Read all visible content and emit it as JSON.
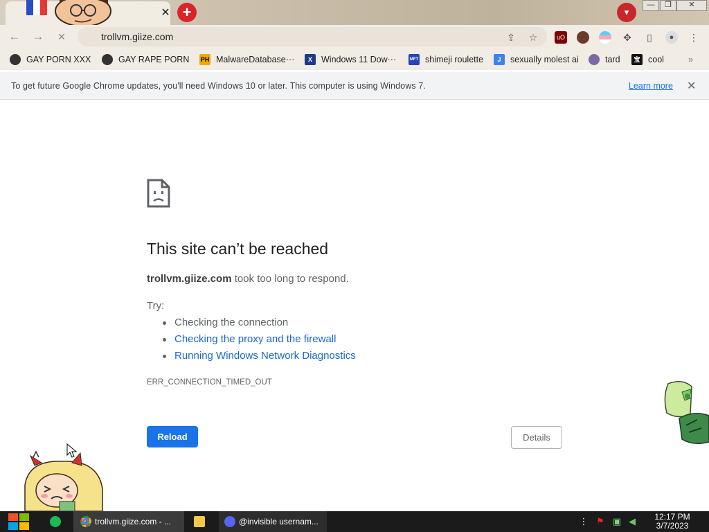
{
  "tab": {
    "close_label": "✕",
    "new_tab_label": "+"
  },
  "window_controls": {
    "minimize": "—",
    "restore": "❐",
    "close": "✕"
  },
  "toolbar": {
    "url": "trollvm.giize.com"
  },
  "bookmarks": [
    {
      "label": "GAY PORN XXX",
      "icon": "github-icon",
      "color": "#333333"
    },
    {
      "label": "GAY RAPE PORN",
      "icon": "globe-icon",
      "color": "#333333"
    },
    {
      "label": "MalwareDatabase···",
      "icon": "ph-icon",
      "color": "#f0a800",
      "text": "PH"
    },
    {
      "label": "Windows 11 Dow···",
      "icon": "x-icon",
      "color": "#1e3a8a",
      "text": "X"
    },
    {
      "label": "shimeji roulette",
      "icon": "mft-icon",
      "color": "#2744b8",
      "text": "MFT"
    },
    {
      "label": "sexually molest ai",
      "icon": "ai-icon",
      "color": "#3b82f6",
      "text": "J"
    },
    {
      "label": "tard",
      "icon": "mask-icon",
      "color": "#7b68a6"
    },
    {
      "label": "cool",
      "icon": "cool-icon",
      "color": "#111111",
      "text": "宝"
    }
  ],
  "infobar": {
    "message": "To get future Google Chrome updates, you'll need Windows 10 or later. This computer is using Windows 7.",
    "link": "Learn more"
  },
  "error": {
    "title": "This site can’t be reached",
    "host": "trollvm.giize.com",
    "host_suffix": " took too long to respond.",
    "try_label": "Try:",
    "suggestions": [
      {
        "text": "Checking the connection",
        "link": false
      },
      {
        "text": "Checking the proxy and the firewall",
        "link": true
      },
      {
        "text": "Running Windows Network Diagnostics",
        "link": true
      }
    ],
    "code": "ERR_CONNECTION_TIMED_OUT",
    "reload_label": "Reload",
    "details_label": "Details"
  },
  "taskbar": {
    "chrome_label": "trollvm.giize.com - ...",
    "discord_label": "@invisible usernam...",
    "time": "12:17 PM",
    "date": "3/7/2023"
  },
  "colors": {
    "accent": "#1a73e8",
    "link": "#1967d2",
    "taskbar": "#1b1b1b"
  }
}
